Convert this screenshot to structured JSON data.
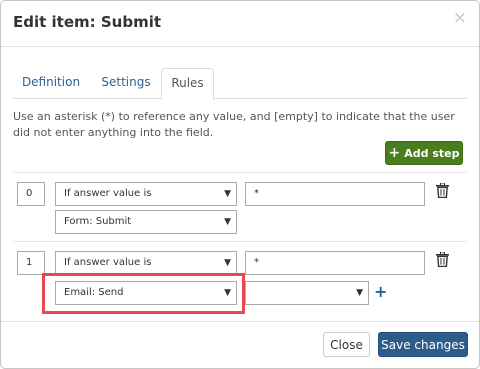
{
  "modal": {
    "title": "Edit item: Submit",
    "close_icon": "close-icon"
  },
  "tabs": [
    {
      "label": "Definition"
    },
    {
      "label": "Settings"
    },
    {
      "label": "Rules",
      "active": true
    }
  ],
  "description": "Use an asterisk (*) to reference any value, and [empty] to indicate that the user did not enter anything into the field.",
  "add_step_label": "Add step",
  "rules": [
    {
      "index": "0",
      "condition": "If answer value is",
      "value": "*",
      "target": "Form: Submit"
    },
    {
      "index": "1",
      "condition": "If answer value is",
      "value": "*",
      "target": "Email: Send",
      "extra_select": ""
    }
  ],
  "footer": {
    "close_label": "Close",
    "save_label": "Save changes"
  },
  "colors": {
    "add_button": "#4a7d1e",
    "save_button": "#2b5c8a",
    "link": "#2a6496",
    "highlight": "#e8484f"
  }
}
